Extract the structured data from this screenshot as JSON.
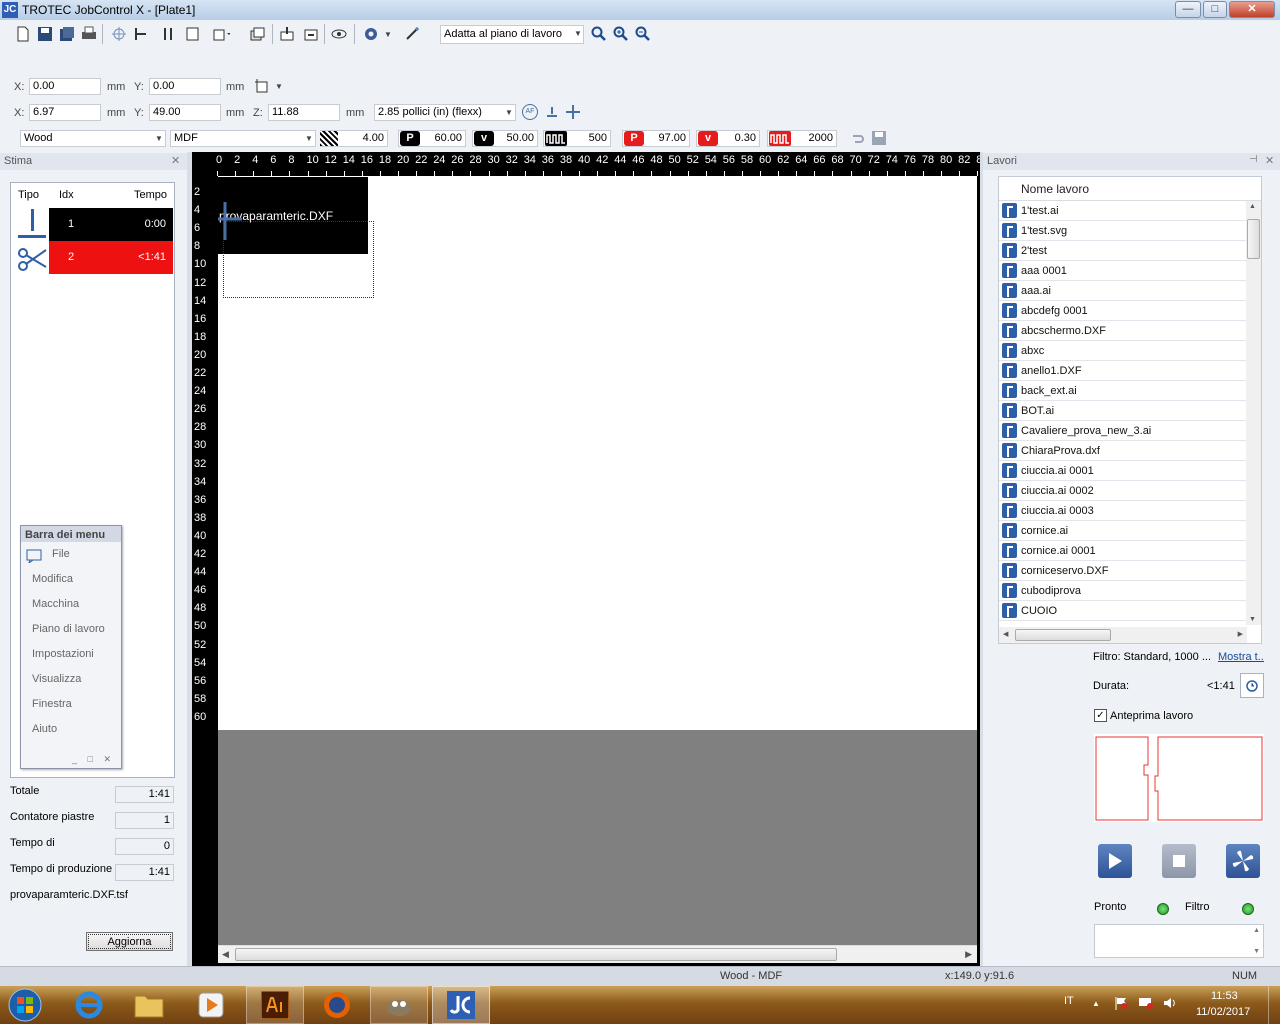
{
  "window": {
    "title": "TROTEC JobControl X - [Plate1]",
    "app_icon": "JC"
  },
  "toolbar": {
    "zoom_select": "Adatta al piano di lavoro"
  },
  "position": {
    "x_label": "X:",
    "x": "0.00",
    "unit": "mm",
    "y_label": "Y:",
    "y": "0.00"
  },
  "size": {
    "x_label": "X:",
    "x": "6.97",
    "unit": "mm",
    "y_label": "Y:",
    "y": "49.00",
    "z_label": "Z:",
    "z": "11.88",
    "height_select": "2.85 pollici (in) (flexx)",
    "af_label": "AF"
  },
  "material": {
    "material": "Wood",
    "type": "MDF",
    "thickness": "4.00",
    "p1": "60.00",
    "v1": "50.00",
    "ppi1": "500",
    "p2": "97.00",
    "v2": "0.30",
    "hz2": "2000",
    "p_badge": "P",
    "v_badge": "v"
  },
  "stima": {
    "title": "Stima",
    "headers": {
      "tipo": "Tipo",
      "idx": "Idx",
      "tempo": "Tempo"
    },
    "rows": [
      {
        "idx": "1",
        "tempo": "0:00",
        "color": "#000000"
      },
      {
        "idx": "2",
        "tempo": "<1:41",
        "color": "#ee1111"
      }
    ],
    "menu": {
      "title": "Barra dei menu",
      "items": [
        "File",
        "Modifica",
        "Macchina",
        "Piano di lavoro",
        "Impostazioni",
        "Visualizza",
        "Finestra",
        "Aiuto"
      ]
    },
    "totale_label": "Totale",
    "totale": "1:41",
    "contatore_label": "Contatore piastre",
    "contatore": "1",
    "movimentazione_label": "Tempo di movimentazione",
    "movimentazione": "0",
    "produzione_label": "Tempo di produzione",
    "produzione": "1:41",
    "file": "provaparamteric.DXF.tsf",
    "aggiorna": "Aggiorna"
  },
  "canvas": {
    "job_label": "provaparamteric.DXF",
    "ruler_top": [
      "0",
      "2",
      "4",
      "6",
      "8",
      "10",
      "12",
      "14",
      "16",
      "18",
      "20",
      "22",
      "24",
      "26",
      "28",
      "30",
      "32",
      "34",
      "36",
      "38",
      "40",
      "42",
      "44",
      "46",
      "48",
      "50",
      "52",
      "54",
      "56",
      "58",
      "60",
      "62",
      "64",
      "66",
      "68",
      "70",
      "72",
      "74",
      "76",
      "78",
      "80",
      "82",
      "8"
    ],
    "ruler_left": [
      "2",
      "4",
      "6",
      "8",
      "10",
      "12",
      "14",
      "16",
      "18",
      "20",
      "22",
      "24",
      "26",
      "28",
      "30",
      "32",
      "34",
      "36",
      "38",
      "40",
      "42",
      "44",
      "46",
      "48",
      "50",
      "52",
      "54",
      "56",
      "58",
      "60"
    ]
  },
  "lavori": {
    "title": "Lavori",
    "col": "Nome lavoro",
    "jobs": [
      "1'test.ai",
      "1'test.svg",
      "2'test",
      "aaa 0001",
      "aaa.ai",
      "abcdefg 0001",
      "abcschermo.DXF",
      "abxc",
      "anello1.DXF",
      "back_ext.ai",
      "BOT.ai",
      "Cavaliere_prova_new_3.ai",
      "ChiaraProva.dxf",
      "ciuccia.ai 0001",
      "ciuccia.ai 0002",
      "ciuccia.ai 0003",
      "cornice.ai",
      "cornice.ai 0001",
      "corniceservo.DXF",
      "cubodiprova",
      "CUOIO"
    ],
    "filtro": "Filtro: Standard, 1000 ...",
    "mostra": "Mostra t...",
    "durata_label": "Durata:",
    "durata": "<1:41",
    "anteprima": "Anteprima lavoro",
    "pronto": "Pronto",
    "filtro_label": "Filtro"
  },
  "status": {
    "material": "Wood - MDF",
    "coords": "x:149.0  y:91.6",
    "num": "NUM"
  },
  "taskbar": {
    "lang": "IT",
    "time": "11:53",
    "date": "11/02/2017"
  }
}
